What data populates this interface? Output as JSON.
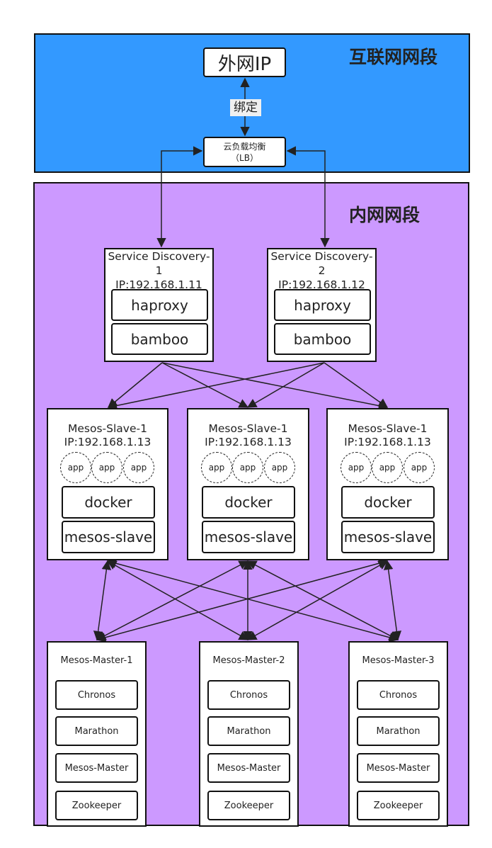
{
  "zones": {
    "internet": "互联网网段",
    "intranet": "内网网段"
  },
  "external_ip": "外网IP",
  "bind_label": "绑定",
  "lb": {
    "line1": "云负载均衡",
    "line2": "（LB）"
  },
  "service_discovery": [
    {
      "title_line1": "Service Discovery-",
      "title_line2": "1",
      "ip": "IP:192.168.1.11",
      "top": "haproxy",
      "bottom": "bamboo"
    },
    {
      "title_line1": "Service Discovery-",
      "title_line2": "2",
      "ip": "IP:192.168.1.12",
      "top": "haproxy",
      "bottom": "bamboo"
    }
  ],
  "slaves": [
    {
      "title": "Mesos-Slave-1",
      "ip": "IP:192.168.1.13",
      "apps": [
        "app",
        "app",
        "app"
      ],
      "top": "docker",
      "bottom": "mesos-slave"
    },
    {
      "title": "Mesos-Slave-1",
      "ip": "IP:192.168.1.13",
      "apps": [
        "app",
        "app",
        "app"
      ],
      "top": "docker",
      "bottom": "mesos-slave"
    },
    {
      "title": "Mesos-Slave-1",
      "ip": "IP:192.168.1.13",
      "apps": [
        "app",
        "app",
        "app"
      ],
      "top": "docker",
      "bottom": "mesos-slave"
    }
  ],
  "masters": [
    {
      "title": "Mesos-Master-1",
      "components": [
        "Chronos",
        "Marathon",
        "Mesos-Master",
        "Zookeeper"
      ]
    },
    {
      "title": "Mesos-Master-2",
      "components": [
        "Chronos",
        "Marathon",
        "Mesos-Master",
        "Zookeeper"
      ]
    },
    {
      "title": "Mesos-Master-3",
      "components": [
        "Chronos",
        "Marathon",
        "Mesos-Master",
        "Zookeeper"
      ]
    }
  ],
  "colors": {
    "internet_zone": "#3399ff",
    "intranet_zone": "#cc99ff",
    "line": "#222222"
  }
}
